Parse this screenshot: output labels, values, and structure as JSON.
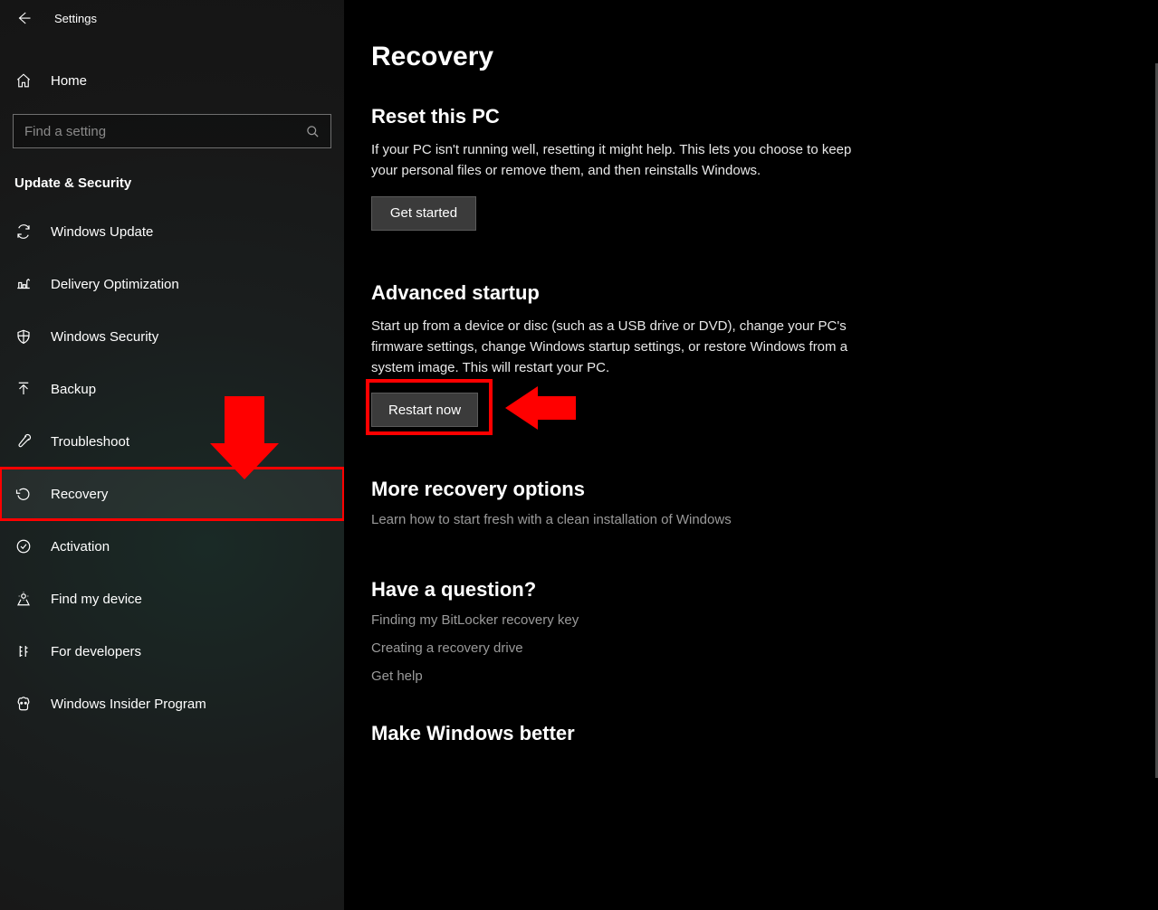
{
  "window": {
    "app_title": "Settings"
  },
  "sidebar": {
    "home_label": "Home",
    "search_placeholder": "Find a setting",
    "category": "Update & Security",
    "items": [
      {
        "id": "windows-update",
        "label": "Windows Update"
      },
      {
        "id": "delivery-optimization",
        "label": "Delivery Optimization"
      },
      {
        "id": "windows-security",
        "label": "Windows Security"
      },
      {
        "id": "backup",
        "label": "Backup"
      },
      {
        "id": "troubleshoot",
        "label": "Troubleshoot"
      },
      {
        "id": "recovery",
        "label": "Recovery"
      },
      {
        "id": "activation",
        "label": "Activation"
      },
      {
        "id": "find-my-device",
        "label": "Find my device"
      },
      {
        "id": "for-developers",
        "label": "For developers"
      },
      {
        "id": "windows-insider",
        "label": "Windows Insider Program"
      }
    ]
  },
  "main": {
    "title": "Recovery",
    "reset": {
      "heading": "Reset this PC",
      "body": "If your PC isn't running well, resetting it might help. This lets you choose to keep your personal files or remove them, and then reinstalls Windows.",
      "button": "Get started"
    },
    "advanced": {
      "heading": "Advanced startup",
      "body": "Start up from a device or disc (such as a USB drive or DVD), change your PC's firmware settings, change Windows startup settings, or restore Windows from a system image. This will restart your PC.",
      "button": "Restart now"
    },
    "more": {
      "heading": "More recovery options",
      "link": "Learn how to start fresh with a clean installation of Windows"
    },
    "question": {
      "heading": "Have a question?",
      "links": [
        "Finding my BitLocker recovery key",
        "Creating a recovery drive",
        "Get help"
      ]
    },
    "better": {
      "heading": "Make Windows better"
    }
  },
  "annotations": {
    "highlighted_sidebar_item": "recovery",
    "highlighted_button": "restart-now"
  }
}
